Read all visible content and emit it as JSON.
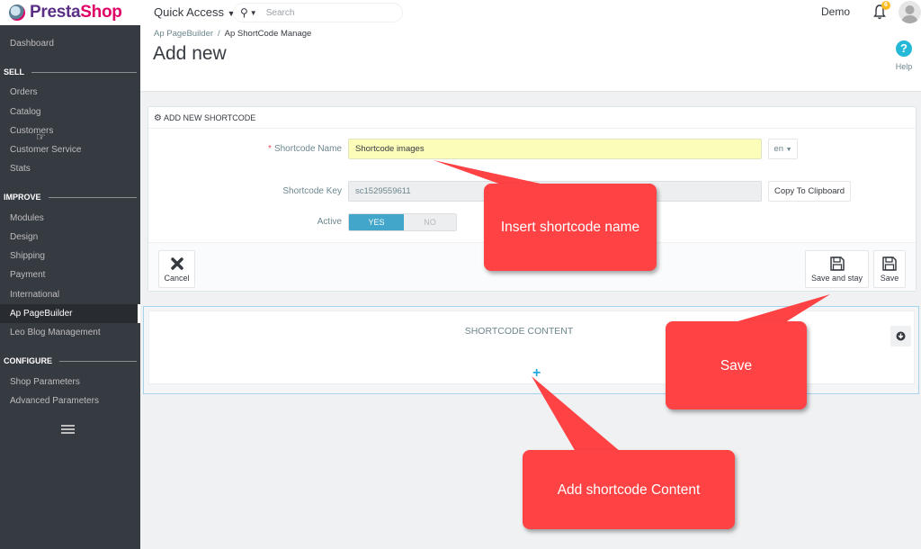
{
  "header": {
    "brand": {
      "part1": "Presta",
      "part2": "Shop"
    },
    "quick_access": "Quick Access",
    "search_placeholder": "Search",
    "user_name": "Demo",
    "notification_count": "6"
  },
  "sidebar": {
    "dashboard": "Dashboard",
    "sections": [
      {
        "title": "SELL",
        "items": [
          "Orders",
          "Catalog",
          "Customers",
          "Customer Service",
          "Stats"
        ]
      },
      {
        "title": "IMPROVE",
        "items": [
          "Modules",
          "Design",
          "Shipping",
          "Payment",
          "International",
          "Ap PageBuilder",
          "Leo Blog Management"
        ]
      },
      {
        "title": "CONFIGURE",
        "items": [
          "Shop Parameters",
          "Advanced Parameters"
        ]
      }
    ],
    "active_item": "Ap PageBuilder"
  },
  "page": {
    "breadcrumb": [
      "Ap PageBuilder",
      "Ap ShortCode Manage"
    ],
    "title": "Add new",
    "help_label": "Help"
  },
  "panel": {
    "heading": "ADD NEW SHORTCODE",
    "name_label": "Shortcode Name",
    "name_value": "Shortcode images",
    "language": "en",
    "key_label": "Shortcode Key",
    "key_value": "sc1529559611",
    "copy_button": "Copy To Clipboard",
    "active_label": "Active",
    "toggle_yes": "YES",
    "toggle_no": "NO",
    "active_value": "YES",
    "cancel": "Cancel",
    "save_and_stay": "Save and stay",
    "save": "Save"
  },
  "content": {
    "title": "SHORTCODE CONTENT",
    "add_symbol": "+"
  },
  "annotations": {
    "insert_name": "Insert shortcode name",
    "save": "Save",
    "add_content": "Add shortcode Content",
    "color": "#ff4244"
  }
}
